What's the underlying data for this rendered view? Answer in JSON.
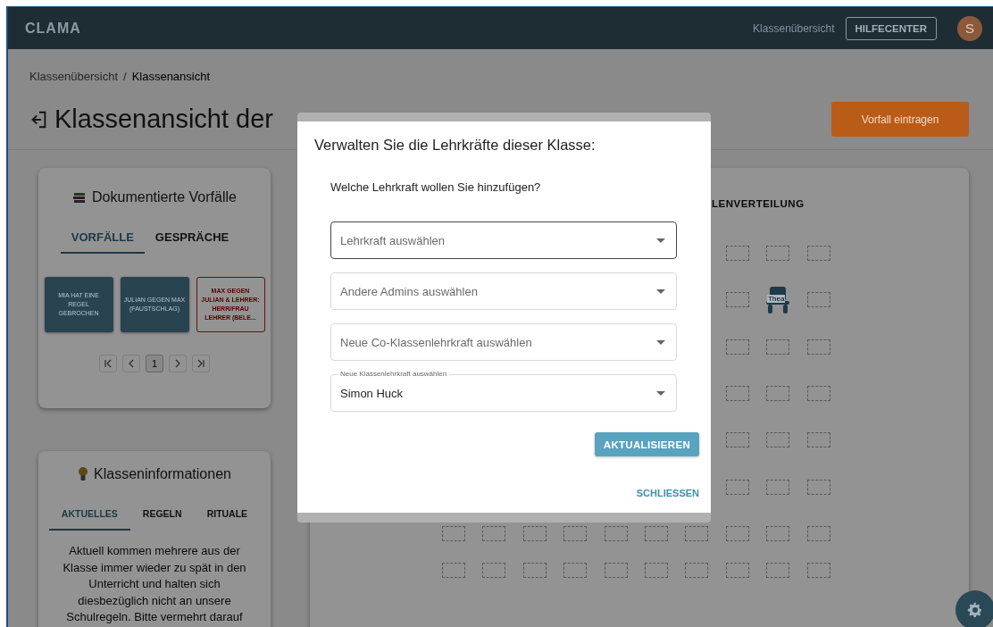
{
  "header": {
    "logo": "CLAMA",
    "nav_link": "Klassenübersicht",
    "help_button": "HILFECENTER",
    "avatar": "S"
  },
  "breadcrumb": {
    "items": [
      {
        "label": "Klassenübersicht",
        "current": false
      },
      {
        "label": "Klassenansicht",
        "current": true
      }
    ],
    "separator": "/"
  },
  "page_title": "Klassenansicht der",
  "primary_button": "Vorfall eintragen",
  "incidents_card": {
    "title": "Dokumentierte Vorfälle",
    "tabs": [
      {
        "label": "VORFÄLLE",
        "selected": true
      },
      {
        "label": "GESPRÄCHE",
        "selected": false
      }
    ],
    "incidents": [
      {
        "text": "MIA HAT EINE REGEL GEBROCHEN",
        "kind": "filled"
      },
      {
        "text": "JULIAN GEGEN MAX (FAUSTSCHLAG)",
        "kind": "filled"
      },
      {
        "text": "MAX GEGEN JULIAN & LEHRER: HERR/FRAU LEHRER (BELE...",
        "kind": "outlined"
      }
    ],
    "page": "1"
  },
  "info_card": {
    "title": "Klasseninformationen",
    "tabs": [
      {
        "label": "AKTUELLES",
        "selected": true
      },
      {
        "label": "REGELN",
        "selected": false
      },
      {
        "label": "RITUALE",
        "selected": false
      }
    ],
    "text": "Aktuell kommen mehrere aus der Klasse immer wieder zu spät in den Unterricht und halten sich diesbezüglich nicht an unsere Schulregeln. Bitte vermehrt darauf"
  },
  "seating": {
    "heading": "LENVERTEILUNG",
    "student": "Thea"
  },
  "dialog": {
    "title": "Verwalten Sie die Lehrkräfte dieser Klasse:",
    "question": "Welche Lehrkraft wollen Sie hinzufügen?",
    "fields": [
      {
        "placeholder": "Lehrkraft auswählen",
        "focused": true
      },
      {
        "placeholder": "Andere Admins auswählen",
        "focused": false
      },
      {
        "placeholder": "Neue Co-Klassenlehrkraft auswählen",
        "focused": false
      },
      {
        "label": "Neue Klassenlehrkraft auswählen",
        "value": "Simon Huck",
        "focused": false
      }
    ],
    "submit_button": "AKTUALISIEREN",
    "close_button": "SCHLIESSEN"
  }
}
